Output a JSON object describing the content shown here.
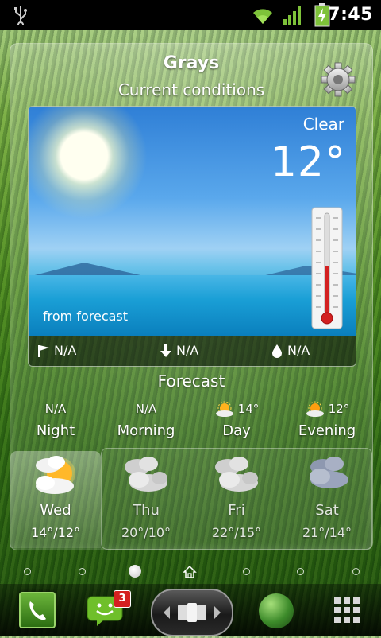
{
  "status_bar": {
    "time": "7:45"
  },
  "widget": {
    "city": "Grays",
    "subtitle": "Current conditions",
    "current": {
      "condition": "Clear",
      "temperature": "12°",
      "source": "from forecast",
      "wind_direction": "N/A",
      "wind_speed": "N/A",
      "humidity": "N/A"
    },
    "forecast_title": "Forecast",
    "periods": [
      {
        "name": "Night",
        "value": "N/A",
        "icon": null
      },
      {
        "name": "Morning",
        "value": "N/A",
        "icon": null
      },
      {
        "name": "Day",
        "value": "14°",
        "icon": "sun-cloud-icon"
      },
      {
        "name": "Evening",
        "value": "12°",
        "icon": "sun-cloud-icon"
      }
    ],
    "days": [
      {
        "name": "Wed",
        "temps": "14°/12°",
        "icon": "sun-cloud-icon"
      },
      {
        "name": "Thu",
        "temps": "20°/10°",
        "icon": "clouds-icon"
      },
      {
        "name": "Fri",
        "temps": "22°/15°",
        "icon": "clouds-icon"
      },
      {
        "name": "Sat",
        "temps": "21°/14°",
        "icon": "dark-clouds-icon"
      }
    ]
  },
  "dock": {
    "messages_badge": "3"
  }
}
